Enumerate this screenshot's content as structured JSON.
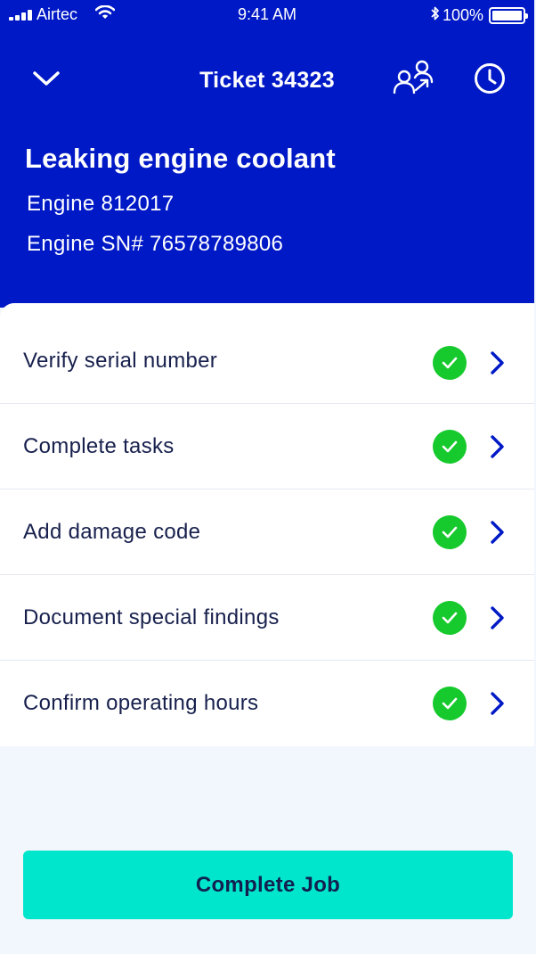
{
  "status_bar": {
    "carrier": "Airtec",
    "time": "9:41 AM",
    "battery": "100%",
    "battery_level": 1.0
  },
  "nav": {
    "title": "Ticket 34323",
    "icons": [
      "chevron-down-icon",
      "assign-person-icon",
      "clock-icon"
    ]
  },
  "ticket": {
    "title": "Leaking engine coolant",
    "engine": "Engine 812017",
    "serial": "Engine SN# 76578789806"
  },
  "tasks": [
    {
      "label": "Verify serial number",
      "status": "done"
    },
    {
      "label": "Complete tasks",
      "status": "done"
    },
    {
      "label": "Add damage code",
      "status": "done"
    },
    {
      "label": "Document special findings",
      "status": "done"
    },
    {
      "label": "Confirm operating hours",
      "status": "done"
    }
  ],
  "actions": {
    "complete_label": "Complete Job"
  },
  "colors": {
    "header_bg": "#0019c6",
    "check_green": "#16c92c",
    "chevron": "#0019c6",
    "button_bg": "#00e6cc",
    "text_dark": "#17204d",
    "page_bg": "#f2f6fd"
  }
}
